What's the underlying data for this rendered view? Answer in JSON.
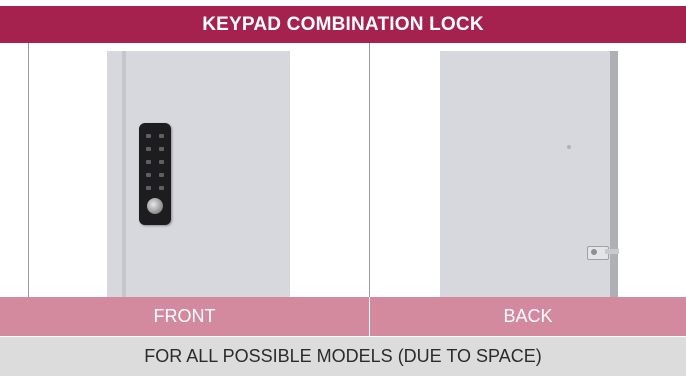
{
  "header": {
    "title": "KEYPAD COMBINATION LOCK"
  },
  "views": [
    {
      "label": "FRONT",
      "image": "locker-door-front-with-keypad-lock"
    },
    {
      "label": "BACK",
      "image": "locker-door-back-with-hinge"
    }
  ],
  "footer": {
    "note": "FOR ALL POSSIBLE MODELS (DUE TO SPACE)"
  },
  "colors": {
    "header_bg": "#a5224f",
    "labels_bg": "#d38a9e",
    "footer_bg": "#dcdcdc",
    "door": "#d7d8dd"
  }
}
